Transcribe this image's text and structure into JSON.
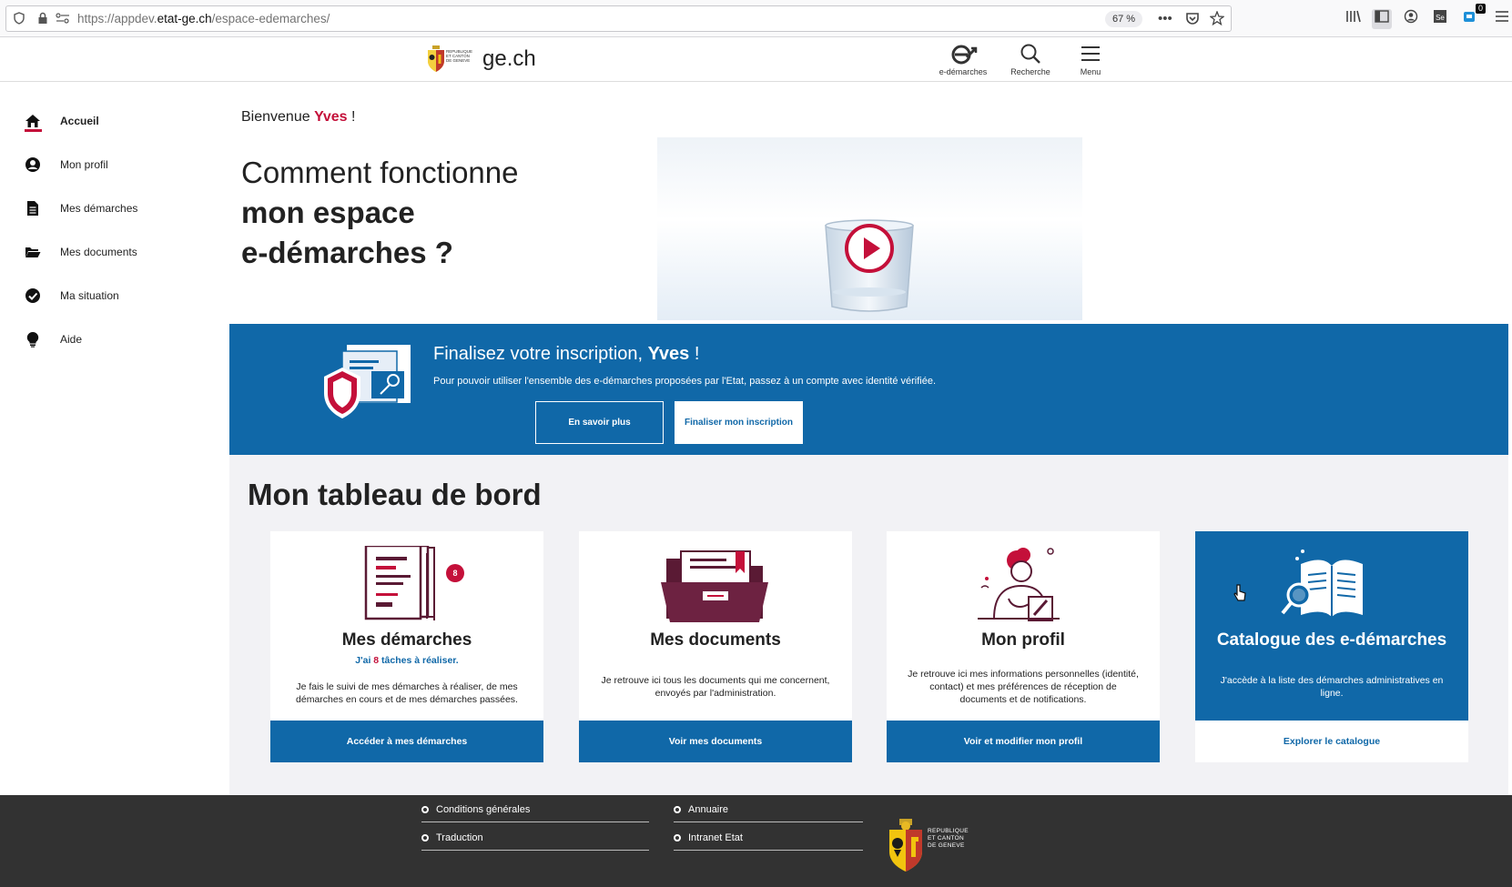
{
  "browser": {
    "url_prefix": "https://appdev.",
    "url_domain": "etat-ge.ch",
    "url_path": "/espace-edemarches/",
    "zoom": "67 %",
    "badge_count": "0",
    "sidebery_label": "Se"
  },
  "header": {
    "brand": "ge.ch",
    "coa_text": "REPUBLIQUE ET CANTON DE GENEVE",
    "edemarches_label": "e-démarches",
    "search_label": "Recherche",
    "menu_label": "Menu"
  },
  "sidebar": {
    "items": [
      {
        "label": "Accueil",
        "icon": "home-icon"
      },
      {
        "label": "Mon profil",
        "icon": "user-circle-icon"
      },
      {
        "label": "Mes démarches",
        "icon": "document-icon"
      },
      {
        "label": "Mes documents",
        "icon": "folder-icon"
      },
      {
        "label": "Ma situation",
        "icon": "check-circle-icon"
      },
      {
        "label": "Aide",
        "icon": "lightbulb-icon"
      }
    ]
  },
  "welcome": {
    "prefix": "Bienvenue ",
    "name": "Yves",
    "suffix": " !"
  },
  "hero": {
    "line1": "Comment fonctionne",
    "line2": "mon espace",
    "line3": "e-démarches ?"
  },
  "banner": {
    "title_prefix": "Finalisez votre inscription, ",
    "title_name": "Yves",
    "title_suffix": " !",
    "text": "Pour pouvoir utiliser l'ensemble des e-démarches proposées par l'Etat, passez à un compte avec identité vérifiée.",
    "btn_more": "En savoir plus",
    "btn_finalize": "Finaliser mon inscription"
  },
  "dashboard": {
    "title_light": "Mon ",
    "title_bold": "tableau de bord",
    "cards": [
      {
        "title": "Mes démarches",
        "badge": "8",
        "sub_prefix": "J'ai ",
        "sub_num": "8",
        "sub_suffix": " tâches à réaliser.",
        "desc": "Je fais le suivi de mes démarches à réaliser, de mes démarches en cours et de mes démarches passées.",
        "button": "Accéder à mes démarches"
      },
      {
        "title": "Mes documents",
        "desc": "Je retrouve ici tous les documents qui me concernent, envoyés par l'administration.",
        "button": "Voir mes documents"
      },
      {
        "title": "Mon profil",
        "desc": "Je retrouve ici mes informations personnelles (identité, contact) et mes préférences de réception de documents et de notifications.",
        "button": "Voir et modifier mon profil"
      },
      {
        "title": "Catalogue des e-démarches",
        "desc": "J'accède à la liste des démarches administratives en ligne.",
        "button": "Explorer le catalogue"
      }
    ]
  },
  "footer": {
    "links_left": [
      "Conditions générales",
      "Traduction"
    ],
    "links_right": [
      "Annuaire",
      "Intranet Etat"
    ],
    "coa_lines": [
      "REPUBLIQUE",
      "ET CANTON",
      "DE GENEVE"
    ]
  },
  "colors": {
    "primary": "#1068a8",
    "accent": "#c4103a",
    "footer_bg": "#323232",
    "dashboard_bg": "#f2f2f5",
    "illustration": "#5a1a34"
  }
}
